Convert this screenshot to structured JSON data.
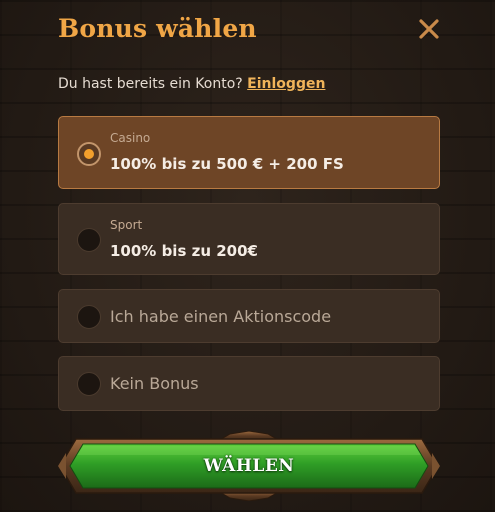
{
  "modal": {
    "title": "Bonus wählen",
    "close_icon": "close-icon"
  },
  "login": {
    "prompt": "Du hast bereits ein Konto?",
    "link_label": "Einloggen"
  },
  "options": [
    {
      "category": "Casino",
      "text": "100% bis zu 500 € + 200 FS",
      "selected": true
    },
    {
      "category": "Sport",
      "text": "100% bis zu 200€",
      "selected": false
    },
    {
      "text": "Ich habe einen Aktionscode",
      "selected": false
    },
    {
      "text": "Kein Bonus",
      "selected": false
    }
  ],
  "submit": {
    "label": "WÄHLEN"
  },
  "colors": {
    "accent": "#f0a646",
    "link": "#f0b45a",
    "selected_bg": "#6e4526",
    "option_bg": "#3a2d23",
    "button_green": "#2f9b2a",
    "radio_dot": "#f3a02c"
  }
}
